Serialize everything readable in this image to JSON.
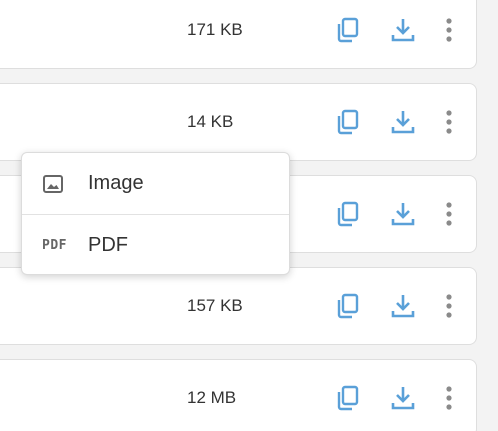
{
  "files": [
    {
      "size": "171 KB"
    },
    {
      "size": "14 KB"
    },
    {
      "size": ""
    },
    {
      "size": "157 KB"
    },
    {
      "size": "12 MB"
    }
  ],
  "actions": {
    "copy_icon": "copy-icon",
    "download_icon": "download-icon",
    "more_icon": "more-vertical-icon"
  },
  "menu": {
    "items": [
      {
        "label": "Image",
        "icon": "image-icon"
      },
      {
        "label": "PDF",
        "icon": "pdf-icon",
        "glyph": "PDF"
      }
    ]
  },
  "colors": {
    "accent": "#5aa0d8",
    "more": "#8a8a8a",
    "text": "#333333"
  }
}
